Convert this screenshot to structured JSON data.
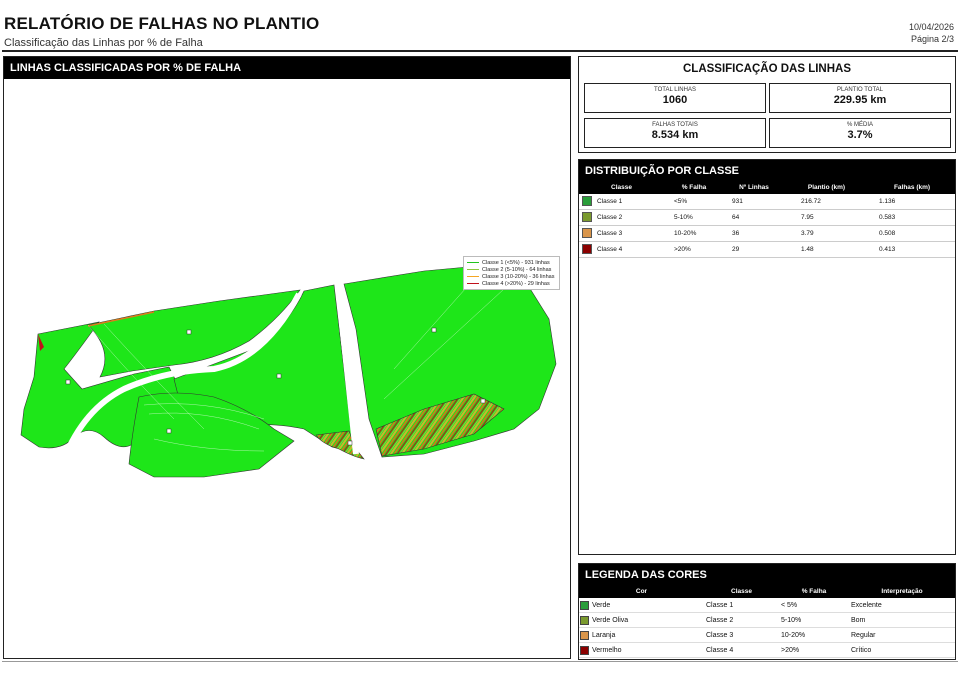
{
  "header": {
    "title": "RELATÓRIO DE FALHAS NO PLANTIO",
    "subtitle": "Classificação das Linhas por % de Falha",
    "date": "10/04/2026",
    "page": "Página 2/3"
  },
  "map": {
    "title": "LINHAS CLASSIFICADAS POR % DE FALHA",
    "legend": [
      {
        "label": "Classe 1 (<5%) - 931 linhas",
        "color": "#22c41f"
      },
      {
        "label": "Classe 2 (5-10%) - 64 linhas",
        "color": "#8dc63f"
      },
      {
        "label": "Classe 3 (10-20%) - 36 linhas",
        "color": "#f5a623"
      },
      {
        "label": "Classe 4 (>20%) - 29 linhas",
        "color": "#c0121b"
      }
    ],
    "field_color": "#1ee619"
  },
  "kpi": {
    "title": "CLASSIFICAÇÃO DAS LINHAS",
    "total_linhas_label": "TOTAL LINHAS",
    "total_linhas": "1060",
    "plantio_total_label": "PLANTIO TOTAL",
    "plantio_total": "229.95 km",
    "falhas_totais_label": "FALHAS TOTAIS",
    "falhas_totais": "8.534 km",
    "media_label": "% MÉDIA",
    "media": "3.7%"
  },
  "distribution": {
    "title": "DISTRIBUIÇÃO POR CLASSE",
    "columns": [
      "Classe",
      "% Falha",
      "Nº Linhas",
      "Plantio (km)",
      "Falhas (km)"
    ],
    "rows": [
      {
        "color": "#2a9d3a",
        "classe": "Classe 1",
        "falha": "<5%",
        "linhas": "931",
        "plantio": "216.72",
        "falhas": "1.136"
      },
      {
        "color": "#7a9a2e",
        "classe": "Classe 2",
        "falha": "5-10%",
        "linhas": "64",
        "plantio": "7.95",
        "falhas": "0.583"
      },
      {
        "color": "#d9954a",
        "classe": "Classe 3",
        "falha": "10-20%",
        "linhas": "36",
        "plantio": "3.79",
        "falhas": "0.508"
      },
      {
        "color": "#8b0000",
        "classe": "Classe 4",
        "falha": ">20%",
        "linhas": "29",
        "plantio": "1.48",
        "falhas": "0.413"
      }
    ]
  },
  "color_legend": {
    "title": "LEGENDA DAS CORES",
    "columns": [
      "Cor",
      "Classe",
      "% Falha",
      "Interpretação"
    ],
    "rows": [
      {
        "color": "#2a9d3a",
        "cor": "Verde",
        "classe": "Classe 1",
        "falha": "< 5%",
        "interp": "Excelente"
      },
      {
        "color": "#7a9a2e",
        "cor": "Verde Oliva",
        "classe": "Classe 2",
        "falha": "5-10%",
        "interp": "Bom"
      },
      {
        "color": "#d9954a",
        "cor": "Laranja",
        "classe": "Classe 3",
        "falha": "10-20%",
        "interp": "Regular"
      },
      {
        "color": "#8b0000",
        "cor": "Vermelho",
        "classe": "Classe 4",
        "falha": ">20%",
        "interp": "Crítico"
      }
    ]
  }
}
